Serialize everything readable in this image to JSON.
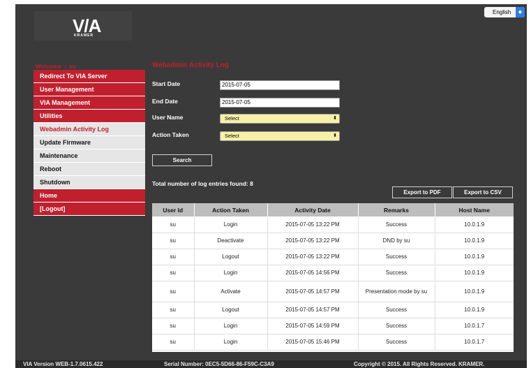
{
  "header": {
    "logo_text": "V/A",
    "logo_subtext": "KRAMER",
    "language": "English",
    "language_arrow": "◆"
  },
  "sidebar": {
    "welcome": "Welcome :: su",
    "items": [
      {
        "label": "Redirect To VIA Server",
        "style": "red"
      },
      {
        "label": "User Management",
        "style": "red"
      },
      {
        "label": "VIA Management",
        "style": "red"
      },
      {
        "label": "Utilities",
        "style": "red"
      },
      {
        "label": "Webadmin Activity Log",
        "style": "active"
      },
      {
        "label": "Update Firmware",
        "style": "grey"
      },
      {
        "label": "Maintenance",
        "style": "grey"
      },
      {
        "label": "Reboot",
        "style": "grey"
      },
      {
        "label": "Shutdown",
        "style": "grey"
      },
      {
        "label": "Home",
        "style": "red"
      },
      {
        "label": "[Logout]",
        "style": "red"
      }
    ]
  },
  "main": {
    "title": "Webadmin Activity Log",
    "form": {
      "start_date_label": "Start Date",
      "start_date_value": "2015-07-05",
      "end_date_label": "End Date",
      "end_date_value": "2015-07-05",
      "user_name_label": "User Name",
      "user_name_value": "Select",
      "action_taken_label": "Action Taken",
      "action_taken_value": "Select",
      "select_arrow": "⬍"
    },
    "search_label": "Search",
    "log_count": "Total number of log entries found: 8",
    "export_pdf_label": "Export to PDF",
    "export_csv_label": "Export to CSV"
  },
  "table": {
    "columns": [
      "User Id",
      "Action Taken",
      "Activity Date",
      "Remarks",
      "Host Name"
    ],
    "rows": [
      [
        "su",
        "Login",
        "2015-07-05 13:22 PM",
        "Success",
        "10.0.1.9"
      ],
      [
        "su",
        "Deactivate",
        "2015-07-05 13:22 PM",
        "DND by su",
        "10.0.1.9"
      ],
      [
        "su",
        "Logout",
        "2015-07-05 13:22 PM",
        "Success",
        "10.0.1.9"
      ],
      [
        "su",
        "Login",
        "2015-07-05 14:56 PM",
        "Success",
        "10.0.1.9"
      ],
      [
        "su",
        "Activate",
        "2015-07-05 14:57 PM",
        "Presentation mode by su",
        "10.0.1.9"
      ],
      [
        "su",
        "Logout",
        "2015-07-05 14:57 PM",
        "Success",
        "10.0.1.9"
      ],
      [
        "su",
        "Login",
        "2015-07-05 14:59 PM",
        "Success",
        "10.0.1.7"
      ],
      [
        "su",
        "Login",
        "2015-07-05 15:46 PM",
        "Success",
        "10.0.1.7"
      ]
    ]
  },
  "footer": {
    "version": "VIA Version WEB-1.7.0615.422",
    "serial": "Serial Number: 0EC5-5D66-86-F59C-C3A9",
    "copyright": "Copyright © 2015. All Rights Reserved. KRAMER."
  },
  "colors": {
    "background": "#3a3a3a",
    "accent_red": "#c0202e",
    "nav_grey": "#e6e6e6",
    "select_yellow": "#f6f1a6",
    "table_header": "#bdbdbd"
  }
}
